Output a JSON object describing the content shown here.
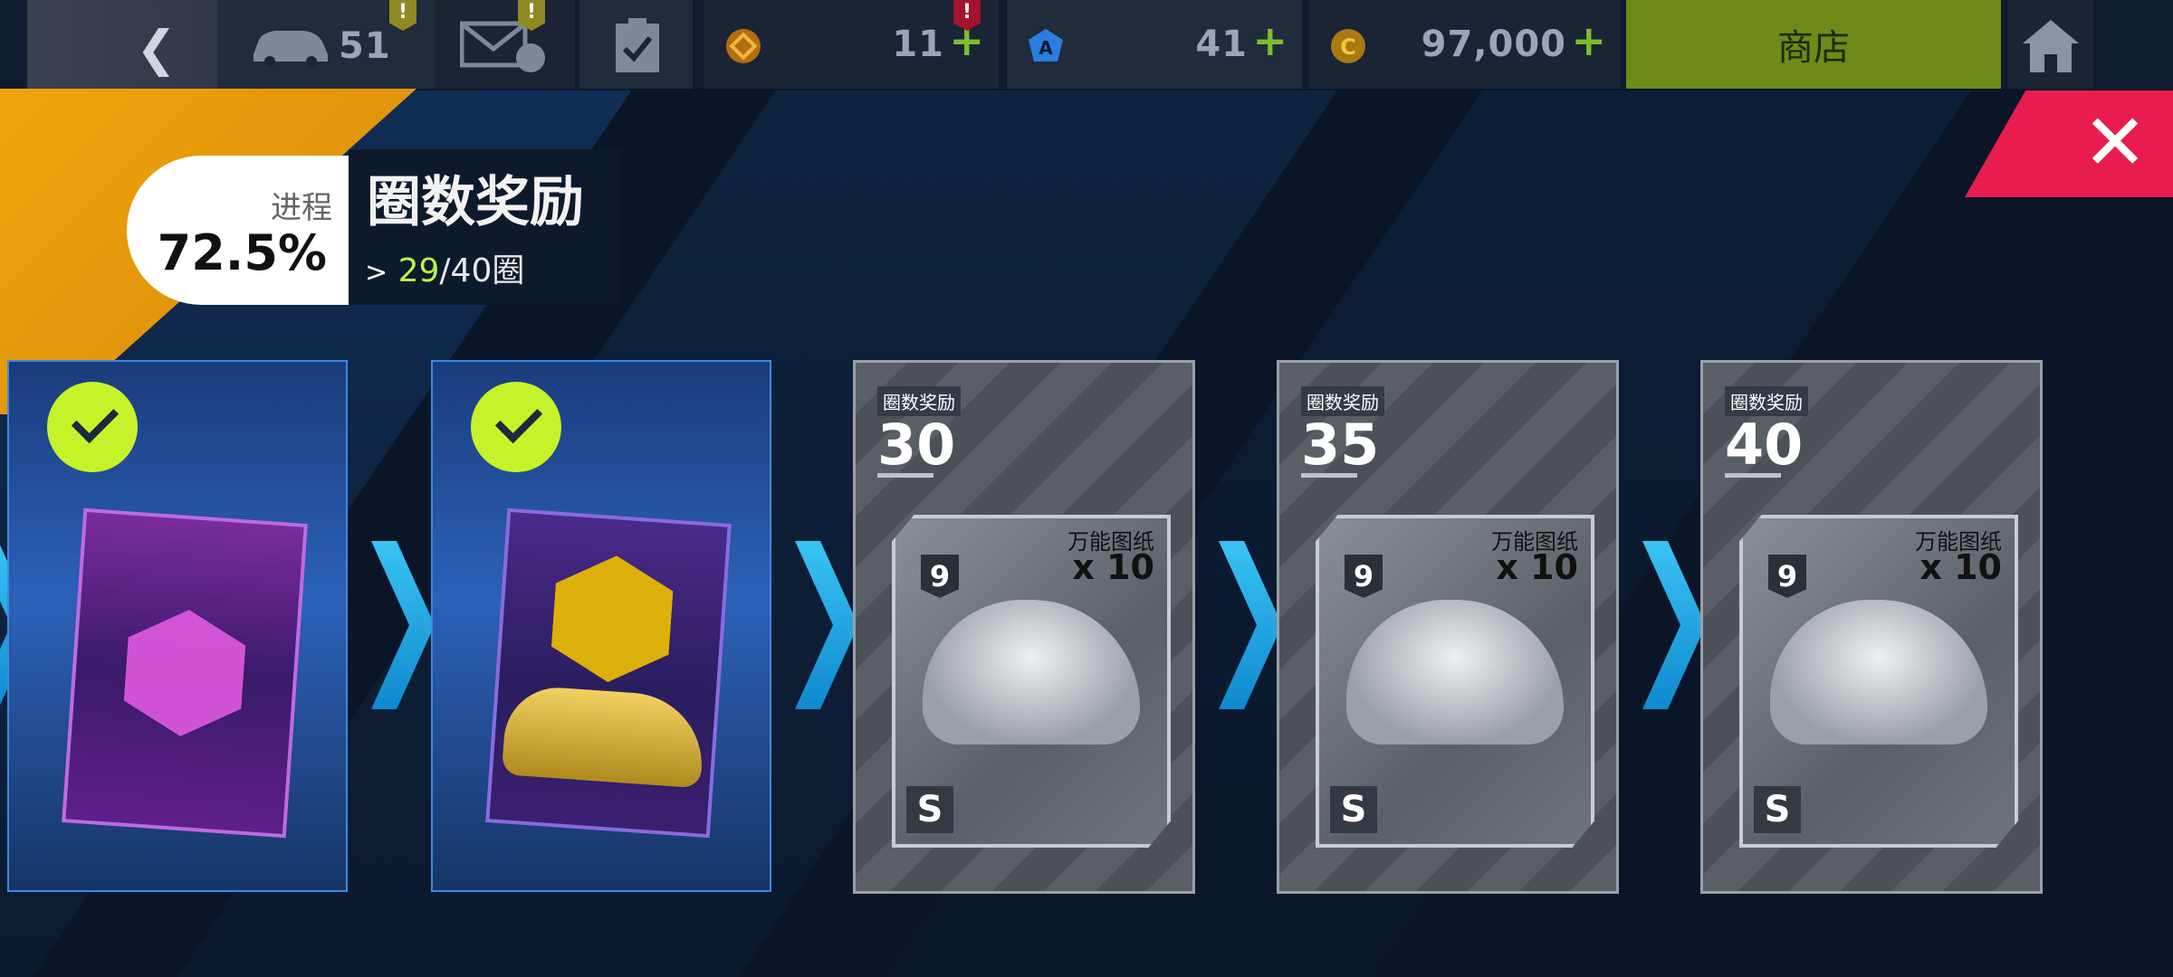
{
  "topbar": {
    "back_icon": "chevron-left-icon",
    "cars_count": "51",
    "cars_badge": "!",
    "mail_badge": "!",
    "currency_a": {
      "value": "11",
      "badge": "!"
    },
    "currency_b": {
      "value": "41"
    },
    "credits": {
      "value": "97,000"
    },
    "plus_symbol": "+",
    "shop_label": "商店"
  },
  "progress": {
    "label": "进程",
    "percent": "72.5%",
    "title": "圈数奖励",
    "laps_current": "29",
    "laps_total": "/40圈",
    "fraction": 0.725
  },
  "close": {
    "symbol": "✕"
  },
  "cards": [
    {
      "state": "claimed",
      "reward": "pack-purple"
    },
    {
      "state": "claimed",
      "reward": "pack-car"
    },
    {
      "state": "locked",
      "label": "圈数奖励",
      "laps": "30",
      "reward_title": "万能图纸",
      "count": "x 10",
      "rank": "9",
      "class": "S"
    },
    {
      "state": "locked",
      "label": "圈数奖励",
      "laps": "35",
      "reward_title": "万能图纸",
      "count": "x 10",
      "rank": "9",
      "class": "S"
    },
    {
      "state": "locked",
      "label": "圈数奖励",
      "laps": "40",
      "reward_title": "万能图纸",
      "count": "x 10",
      "rank": "9",
      "class": "S"
    }
  ],
  "colors": {
    "accent_green": "#b9f54a",
    "shop_green": "#6e8a18",
    "close_red": "#e81d4d",
    "orange": "#f0a60c",
    "arrow_blue": "#39c3f2"
  }
}
